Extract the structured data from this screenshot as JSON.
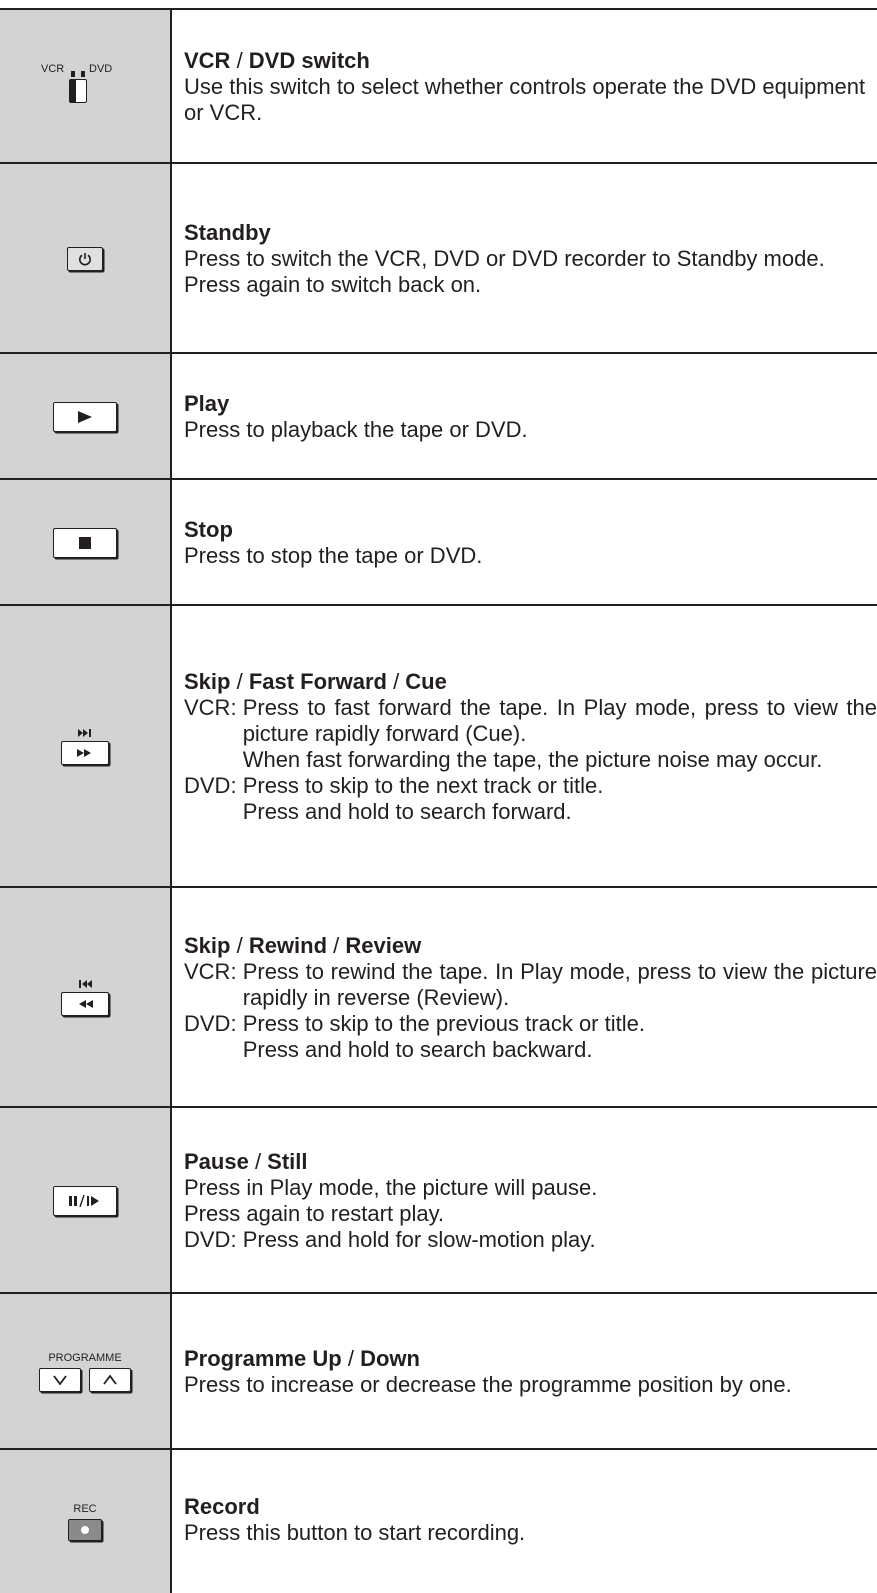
{
  "rows": [
    {
      "title": [
        "VCR",
        " / ",
        "DVD switch"
      ],
      "lines": [
        "Use this switch to select whether controls operate the DVD equipment or VCR."
      ],
      "icon": "vcr-dvd-switch-icon",
      "icon_labels": {
        "left": "VCR",
        "right": "DVD"
      }
    },
    {
      "title": [
        "Standby"
      ],
      "lines": [
        "Press to switch the VCR, DVD or DVD recorder to Standby mode.",
        "Press again to switch back on."
      ],
      "icon": "power-icon"
    },
    {
      "title": [
        "Play"
      ],
      "lines": [
        "Press to playback the tape or DVD."
      ],
      "icon": "play-icon"
    },
    {
      "title": [
        "Stop"
      ],
      "lines": [
        "Press to stop the tape or DVD."
      ],
      "icon": "stop-icon"
    },
    {
      "title": [
        "Skip",
        " / ",
        "Fast Forward",
        " / ",
        "Cue"
      ],
      "vcr_label": "VCR: ",
      "vcr_lines": [
        "Press to fast forward the tape. In Play mode, press to view the picture rapidly forward (Cue).",
        "When fast forwarding the tape, the picture noise may occur."
      ],
      "dvd_label": "DVD: ",
      "dvd_lines": [
        "Press to skip to the next track or title.",
        "Press and hold to search forward."
      ],
      "icon": "skip-forward-icon"
    },
    {
      "title": [
        "Skip",
        " / ",
        "Rewind",
        " / ",
        "Review"
      ],
      "vcr_label": "VCR: ",
      "vcr_lines": [
        "Press to rewind the tape. In Play mode, press to view the picture rapidly in reverse (Review)."
      ],
      "dvd_label": "DVD: ",
      "dvd_lines": [
        "Press to skip to the previous track or title.",
        "Press and hold to search backward."
      ],
      "icon": "skip-rewind-icon"
    },
    {
      "title": [
        "Pause",
        " / ",
        "Still"
      ],
      "lines": [
        "Press in Play mode, the picture will pause.",
        "Press again to restart play."
      ],
      "dvd_label": "DVD: ",
      "dvd_lines": [
        "Press and hold for slow-motion play."
      ],
      "icon": "pause-still-icon"
    },
    {
      "title": [
        "Programme Up",
        " / ",
        "Down"
      ],
      "lines": [
        "Press to increase or decrease the programme position by one."
      ],
      "icon": "programme-up-down-icon",
      "icon_labels": {
        "top": "PROGRAMME"
      }
    },
    {
      "title": [
        "Record"
      ],
      "lines": [
        "Press this button to start recording."
      ],
      "icon": "record-icon",
      "icon_labels": {
        "top": "REC"
      }
    }
  ]
}
